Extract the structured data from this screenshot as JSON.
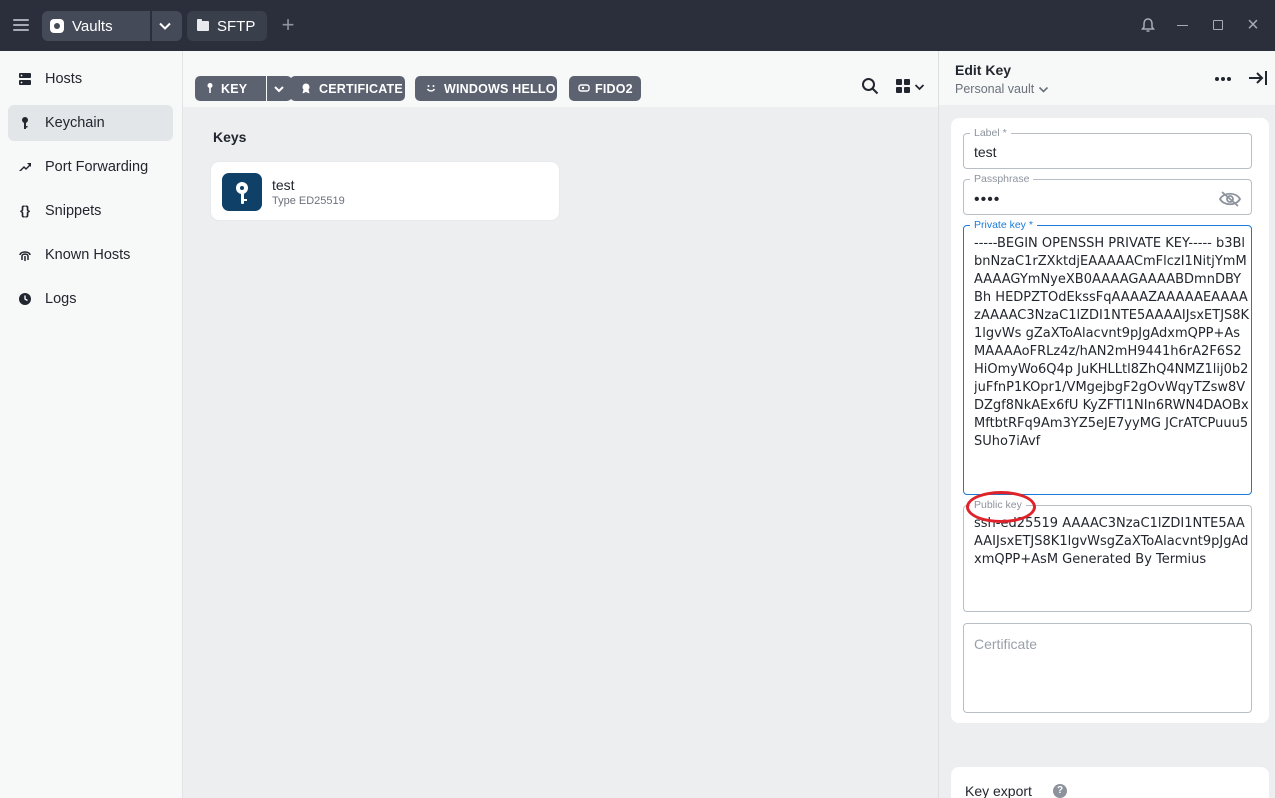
{
  "titlebar": {
    "tabs": [
      {
        "label": "Vaults"
      },
      {
        "label": "SFTP"
      }
    ],
    "add_tab": "+"
  },
  "sidebar": {
    "items": [
      {
        "label": "Hosts",
        "icon": "hosts-icon"
      },
      {
        "label": "Keychain",
        "icon": "key-icon",
        "active": true
      },
      {
        "label": "Port Forwarding",
        "icon": "port-forwarding-icon"
      },
      {
        "label": "Snippets",
        "icon": "snippets-icon"
      },
      {
        "label": "Known Hosts",
        "icon": "fingerprint-icon"
      },
      {
        "label": "Logs",
        "icon": "logs-icon"
      }
    ]
  },
  "toolbar": {
    "buttons": [
      {
        "label": "KEY"
      },
      {
        "label": "CERTIFICATE"
      },
      {
        "label": "WINDOWS HELLO"
      },
      {
        "label": "FIDO2"
      }
    ]
  },
  "main": {
    "section_title": "Keys",
    "keys": [
      {
        "name": "test",
        "type": "Type ED25519"
      }
    ]
  },
  "panel": {
    "title": "Edit Key",
    "subtitle": "Personal vault",
    "label_field": {
      "label": "Label *",
      "value": "test"
    },
    "passphrase_field": {
      "label": "Passphrase",
      "value": "••••"
    },
    "private_key_field": {
      "label": "Private key *",
      "value": "-----BEGIN OPENSSH PRIVATE KEY----- b3BlbnNzaC1rZXktdjEAAAAACmFlczI1NitjYmMAAAAGYmNyeXB0AAAAGAAAABDmnDBYBh HEDPZTOdEkssFqAAAAZAAAAAEAAAAzAAAAC3NzaC1lZDI1NTE5AAAAIJsxETJS8K1lgvWs gZaXToAlacvnt9pJgAdxmQPP+AsMAAAAoFRLz4z/hAN2mH9441h6rA2F6S2HiOmyWo6Q4p JuKHLLtl8ZhQ4NMZ1lij0b2juFfnP1KOpr1/VMgejbgF2gOvWqyTZsw8VDZgf8NkAEx6fU KyZFTI1NIn6RWN4DAOBxMftbtRFq9Am3YZ5eJE7yyMG JCrATCPuuu5SUho7iAvf"
    },
    "public_key_field": {
      "label": "Public key",
      "value": "ssh-ed25519 AAAAC3NzaC1lZDI1NTE5AAAAIJsxETJS8K1lgvWsgZaXToAlacvnt9pJgAdxmQPP+AsM Generated By Termius"
    },
    "certificate_field": {
      "placeholder": "Certificate"
    },
    "export_title": "Key export",
    "help": "?"
  },
  "colors": {
    "titlebar": "#2b2f3c",
    "accent": "#1c7ad6",
    "key_avatar": "#0e4068",
    "annotation": "#e0232a"
  }
}
